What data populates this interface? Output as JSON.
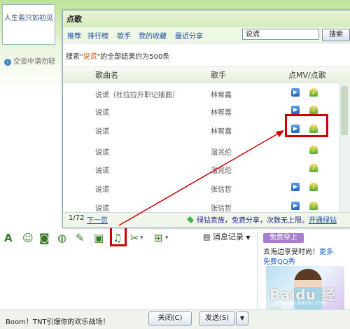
{
  "chat": {
    "avatar_text": "人生若只如初见",
    "notice": "交谈中请勿轻",
    "toolbar_message_record": "消息记录",
    "toolbar_dropdown": "▼",
    "bottom_status": "Boom！TNT引爆你的欢乐战场！",
    "close_label": "关闭(C)",
    "send_label": "发送(S)",
    "send_arrow": "▼"
  },
  "ad": {
    "button": "免费穿上",
    "line1": "去海边享受时尚！",
    "line1_link": "更多",
    "line2": "免费QQ秀",
    "watermark": "Baidu 经验",
    "watermark_url": "jingyan.baidu.com"
  },
  "dialog": {
    "title": "点歌",
    "nav": [
      "推荐",
      "排行榜",
      "歌手",
      "我的收藏",
      "最近分享"
    ],
    "search_value": "说谎",
    "search_button": "搜索",
    "result_prefix": "搜索\"",
    "result_keyword": "说谎",
    "result_suffix": "\"的全部结果约为500条",
    "headers": {
      "song": "歌曲名",
      "singer": "歌手",
      "action": "点MV/点歌"
    },
    "rows": [
      {
        "song": "说谎（杜拉拉升职记插曲）",
        "singer": "林宥嘉",
        "mv": true
      },
      {
        "song": "说谎",
        "singer": "林宥嘉",
        "mv": true
      },
      {
        "song": "说谎",
        "singer": "林宥嘉",
        "mv": true
      },
      {
        "song": "说谎",
        "singer": "温兆伦",
        "mv": false
      },
      {
        "song": "说谎",
        "singer": "温兆伦",
        "mv": false
      },
      {
        "song": "说谎",
        "singer": "张信哲",
        "mv": true
      },
      {
        "song": "说谎",
        "singer": "张信哲",
        "mv": true
      }
    ],
    "page": "1/72",
    "next_page": "下一页",
    "promo_text": "绿钻贵族，免费分享，次数无上限。",
    "promo_link": "开通绿钻"
  },
  "colors": {
    "highlight": "#cc0000",
    "link": "#1a4b9c"
  }
}
